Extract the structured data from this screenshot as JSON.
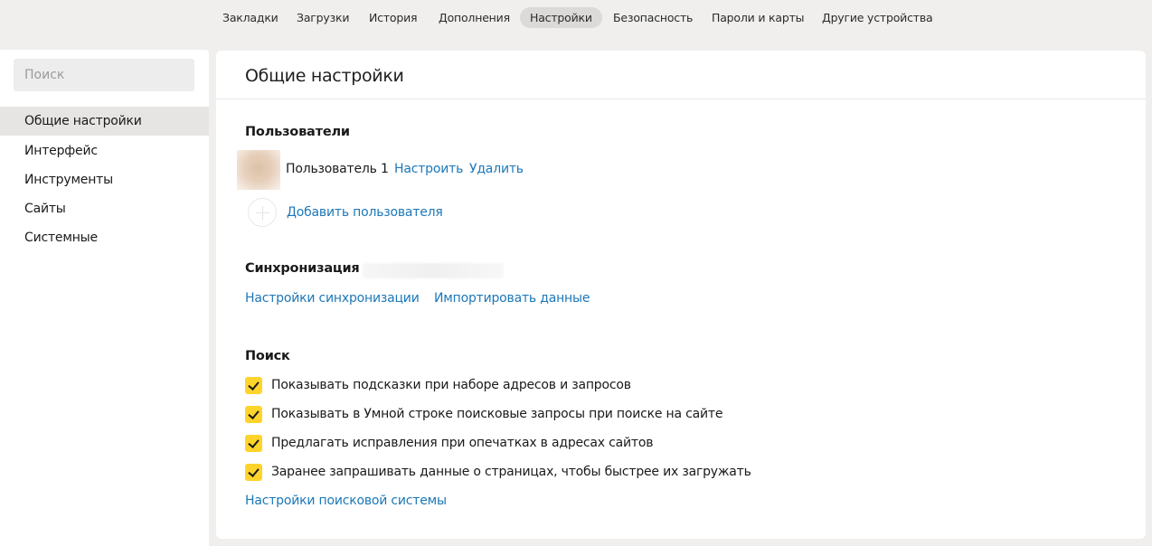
{
  "topnav": {
    "tabs": [
      {
        "label": "Закладки"
      },
      {
        "label": "Загрузки"
      },
      {
        "label": "История"
      },
      {
        "label": "Дополнения"
      },
      {
        "label": "Настройки",
        "active": true
      },
      {
        "label": "Безопасность"
      },
      {
        "label": "Пароли и карты"
      },
      {
        "label": "Другие устройства"
      }
    ]
  },
  "sidebar": {
    "search_placeholder": "Поиск",
    "items": [
      {
        "label": "Общие настройки",
        "active": true
      },
      {
        "label": "Интерфейс"
      },
      {
        "label": "Инструменты"
      },
      {
        "label": "Сайты"
      },
      {
        "label": "Системные"
      }
    ]
  },
  "main": {
    "title": "Общие настройки",
    "users": {
      "title": "Пользователи",
      "user_name": "Пользователь 1",
      "configure_link": "Настроить",
      "delete_link": "Удалить",
      "add_user_link": "Добавить пользователя"
    },
    "sync": {
      "title": "Синхронизация",
      "settings_link": "Настройки синхронизации",
      "import_link": "Импортировать данные"
    },
    "search": {
      "title": "Поиск",
      "options": [
        {
          "label": "Показывать подсказки при наборе адресов и запросов",
          "checked": true
        },
        {
          "label": "Показывать в Умной строке поисковые запросы при поиске на сайте",
          "checked": true
        },
        {
          "label": "Предлагать исправления при опечатках в адресах сайтов",
          "checked": true
        },
        {
          "label": "Заранее запрашивать данные о страницах, чтобы быстрее их загружать",
          "checked": true
        }
      ],
      "engine_settings_link": "Настройки поисковой системы"
    }
  },
  "colors": {
    "accent_link": "#1c78b8",
    "checkbox": "#fed42b",
    "page_background": "#f0efee"
  }
}
